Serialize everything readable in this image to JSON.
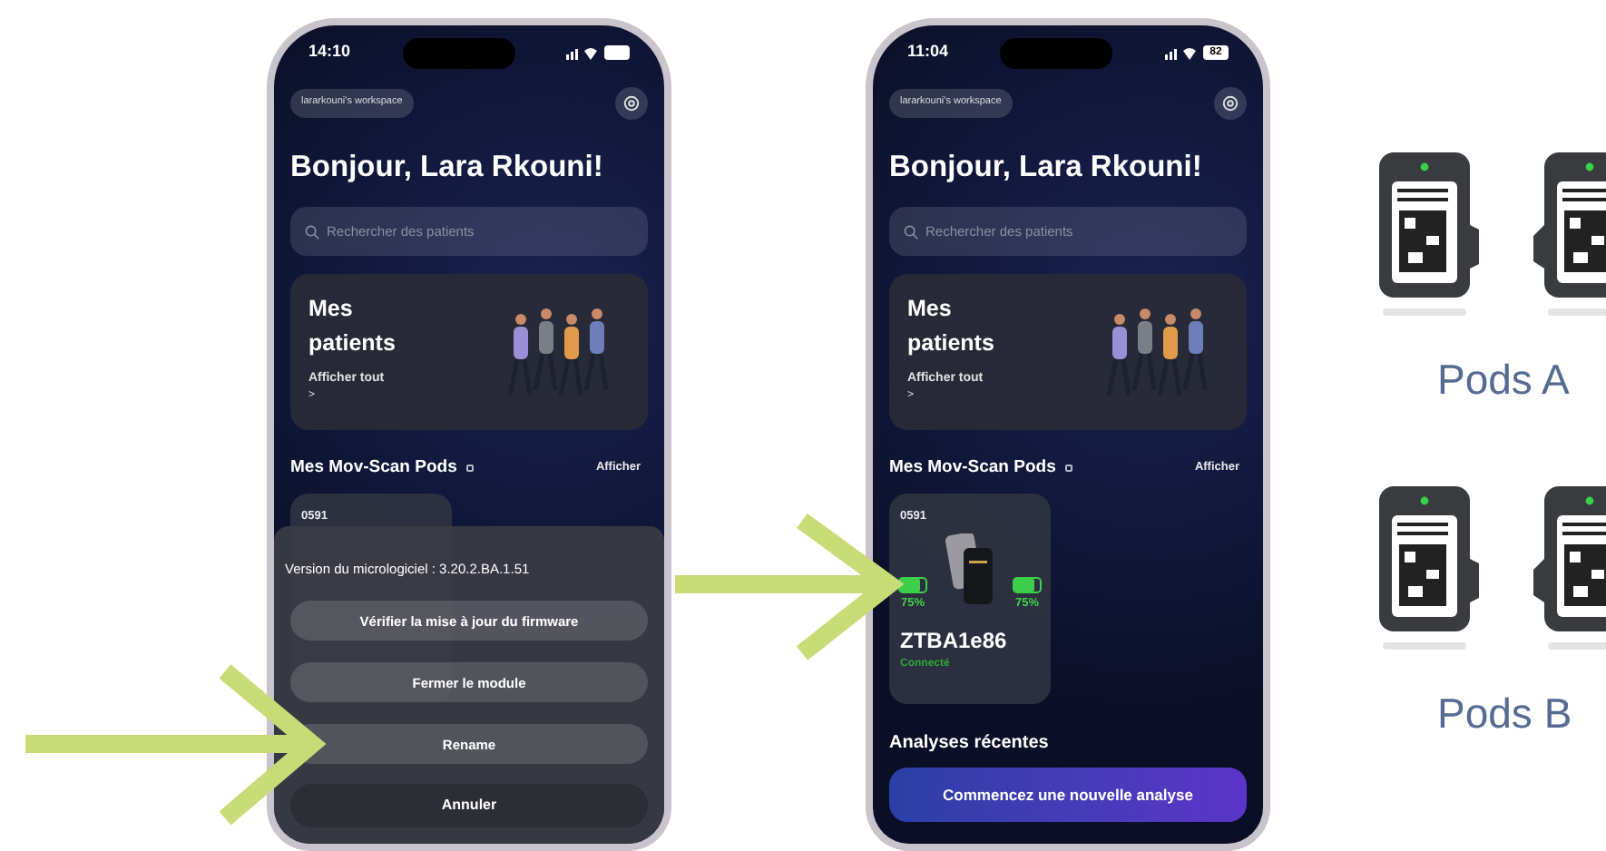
{
  "phones": [
    {
      "time": "14:10",
      "workspace": "lararkouni's workspace",
      "greeting": "Bonjour, Lara Rkouni!",
      "search": {
        "placeholder": "Rechercher des patients"
      },
      "patients_card": {
        "title": "Mes patients",
        "link": "Afficher tout",
        "chevron": ">"
      },
      "pods_section": {
        "title": "Mes Mov-Scan Pods",
        "action": "Afficher"
      },
      "pod_card": {
        "id": "0591"
      },
      "sheet": {
        "version": "Version du micrologiciel : 3.20.2.BA.1.51",
        "actions": [
          "Vérifier la mise à jour du firmware",
          "Fermer le module",
          "Rename"
        ],
        "cancel": "Annuler"
      }
    },
    {
      "time": "11:04",
      "battery": "82",
      "workspace": "lararkouni's workspace",
      "greeting": "Bonjour, Lara Rkouni!",
      "search": {
        "placeholder": "Rechercher des patients"
      },
      "patients_card": {
        "title": "Mes patients",
        "link": "Afficher tout",
        "chevron": ">"
      },
      "pods_section": {
        "title": "Mes Mov-Scan Pods",
        "action": "Afficher"
      },
      "pod_card": {
        "id": "0591",
        "batteries": [
          {
            "level": 0.75,
            "reading": "75%"
          },
          {
            "level": 0.75,
            "reading": "75%"
          }
        ],
        "name": "ZTBA1e86",
        "status": "Connecté"
      },
      "recent_title": "Analyses récentes",
      "cta": "Commencez une nouvelle analyse"
    }
  ],
  "pod_groups": [
    {
      "label": "Pods A"
    },
    {
      "label": "Pods B"
    }
  ]
}
